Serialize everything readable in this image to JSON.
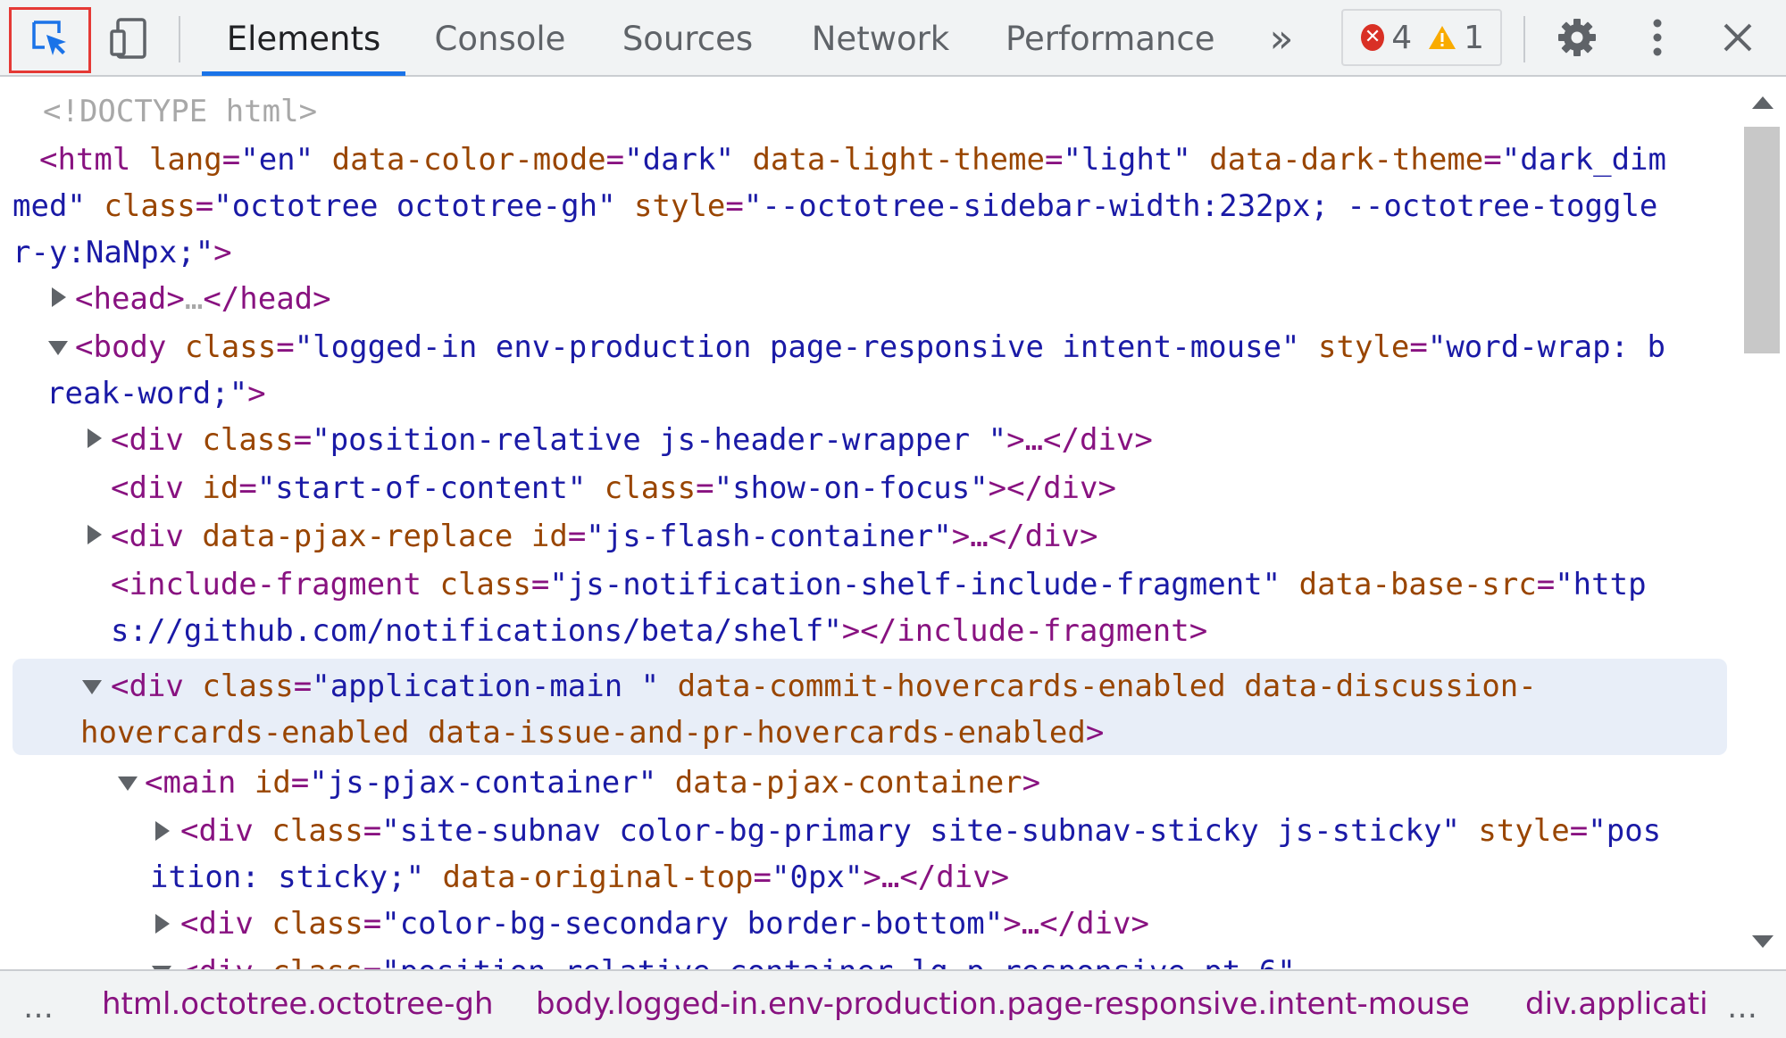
{
  "toolbar": {
    "tabs": [
      "Elements",
      "Console",
      "Sources",
      "Network",
      "Performance"
    ],
    "more_tabs": "»",
    "errors_count": "4",
    "warnings_count": "1",
    "active_tab": "Elements",
    "colors": {
      "accent": "#1a73e8",
      "inspect_highlight": "#e53935"
    }
  },
  "tree": {
    "doctype": "<!DOCTYPE html>",
    "html_tag": "<html",
    "html_lang_attr": "lang",
    "html_lang_val": "\"en\"",
    "html_colormode_attr": "data-color-mode",
    "html_colormode_val": "\"dark\"",
    "html_light_attr": "data-light-theme",
    "html_light_val": "\"light\"",
    "html_dark_attr": "data-dark-theme",
    "html_dark_val_1": "\"dark_dim",
    "html_dark_val_2": "med\"",
    "html_class_attr": "class",
    "html_class_val": "\"octotree octotree-gh\"",
    "html_style_attr": "style",
    "html_style_val_1": "\"--octotree-sidebar-width:232px; --octotree-toggle",
    "html_style_val_2": "r-y:NaNpx;\"",
    "head_open": "<head>",
    "head_ellipsis": "…",
    "head_close": "</head>",
    "body_tag": "<body",
    "body_class_attr": "class",
    "body_class_val": "\"logged-in env-production page-responsive intent-mouse\"",
    "body_style_attr": "style",
    "body_style_val_1": "\"word-wrap: b",
    "body_style_val_2": "reak-word;\"",
    "div1_tag": "<div",
    "div1_class_attr": "class",
    "div1_class_val": "\"position-relative js-header-wrapper \"",
    "div1_close": "…</div>",
    "div2_tag": "<div",
    "div2_id_attr": "id",
    "div2_id_val": "\"start-of-content\"",
    "div2_class_attr": "class",
    "div2_class_val": "\"show-on-focus\"",
    "div2_close": "</div>",
    "div3_tag": "<div",
    "div3_pjax_attr": "data-pjax-replace",
    "div3_id_attr": "id",
    "div3_id_val": "\"js-flash-container\"",
    "div3_close": "…</div>",
    "frag_tag": "<include-fragment",
    "frag_class_attr": "class",
    "frag_class_val": "\"js-notification-shelf-include-fragment\"",
    "frag_src_attr": "data-base-src",
    "frag_src_val_1": "\"http",
    "frag_src_val_2": "s://github.com/notifications/beta/shelf\"",
    "frag_close": "</include-fragment>",
    "app_tag": "<div",
    "app_class_attr": "class",
    "app_class_val": "\"application-main \"",
    "app_attr_1": "data-commit-hovercards-enabled",
    "app_attr_2": "data-discussion-",
    "app_attr_3": "hovercards-enabled",
    "app_attr_4": "data-issue-and-pr-hovercards-enabled",
    "main_tag": "<main",
    "main_id_attr": "id",
    "main_id_val": "\"js-pjax-container\"",
    "main_pjax_attr": "data-pjax-container",
    "subnav_tag": "<div",
    "subnav_class_attr": "class",
    "subnav_class_val": "\"site-subnav color-bg-primary site-subnav-sticky js-sticky\"",
    "subnav_style_attr": "style",
    "subnav_style_val_1": "\"pos",
    "subnav_style_val_2": "ition: sticky;\"",
    "subnav_top_attr": "data-original-top",
    "subnav_top_val": "\"0px\"",
    "subnav_close": "…</div>",
    "sec_tag": "<div",
    "sec_class_attr": "class",
    "sec_class_val": "\"color-bg-secondary border-bottom\"",
    "sec_close": "…</div>",
    "last_tag": "<div",
    "last_class_attr": "class",
    "last_class_val": "\"position-relative container-lg p-responsive pt-6\""
  },
  "breadcrumb": {
    "left_ellipsis": "…",
    "items": [
      "html.octotree.octotree-gh",
      "body.logged-in.env-production.page-responsive.intent-mouse",
      "div.applicati"
    ],
    "right_ellipsis": "…"
  }
}
